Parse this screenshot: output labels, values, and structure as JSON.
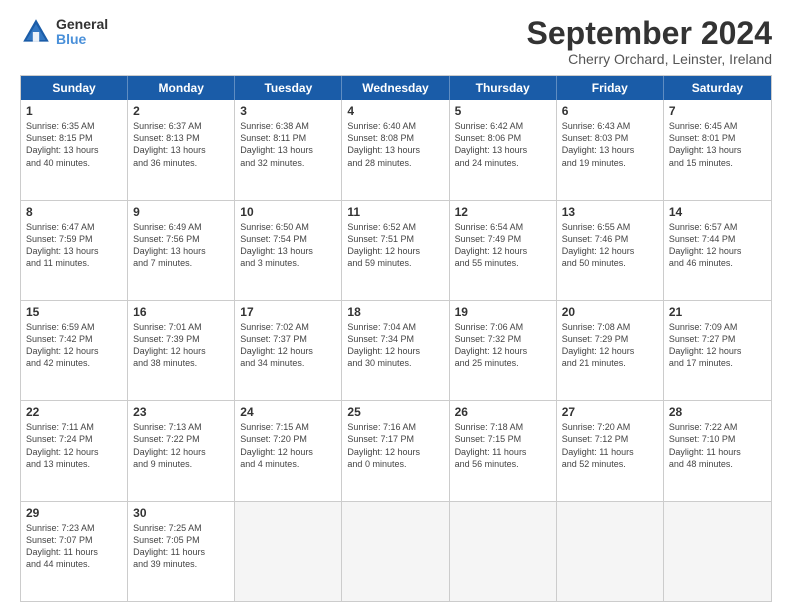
{
  "header": {
    "logo_line1": "General",
    "logo_line2": "Blue",
    "month_title": "September 2024",
    "location": "Cherry Orchard, Leinster, Ireland"
  },
  "days_of_week": [
    "Sunday",
    "Monday",
    "Tuesday",
    "Wednesday",
    "Thursday",
    "Friday",
    "Saturday"
  ],
  "rows": [
    [
      {
        "day": "1",
        "lines": [
          "Sunrise: 6:35 AM",
          "Sunset: 8:15 PM",
          "Daylight: 13 hours",
          "and 40 minutes."
        ]
      },
      {
        "day": "2",
        "lines": [
          "Sunrise: 6:37 AM",
          "Sunset: 8:13 PM",
          "Daylight: 13 hours",
          "and 36 minutes."
        ]
      },
      {
        "day": "3",
        "lines": [
          "Sunrise: 6:38 AM",
          "Sunset: 8:11 PM",
          "Daylight: 13 hours",
          "and 32 minutes."
        ]
      },
      {
        "day": "4",
        "lines": [
          "Sunrise: 6:40 AM",
          "Sunset: 8:08 PM",
          "Daylight: 13 hours",
          "and 28 minutes."
        ]
      },
      {
        "day": "5",
        "lines": [
          "Sunrise: 6:42 AM",
          "Sunset: 8:06 PM",
          "Daylight: 13 hours",
          "and 24 minutes."
        ]
      },
      {
        "day": "6",
        "lines": [
          "Sunrise: 6:43 AM",
          "Sunset: 8:03 PM",
          "Daylight: 13 hours",
          "and 19 minutes."
        ]
      },
      {
        "day": "7",
        "lines": [
          "Sunrise: 6:45 AM",
          "Sunset: 8:01 PM",
          "Daylight: 13 hours",
          "and 15 minutes."
        ]
      }
    ],
    [
      {
        "day": "8",
        "lines": [
          "Sunrise: 6:47 AM",
          "Sunset: 7:59 PM",
          "Daylight: 13 hours",
          "and 11 minutes."
        ]
      },
      {
        "day": "9",
        "lines": [
          "Sunrise: 6:49 AM",
          "Sunset: 7:56 PM",
          "Daylight: 13 hours",
          "and 7 minutes."
        ]
      },
      {
        "day": "10",
        "lines": [
          "Sunrise: 6:50 AM",
          "Sunset: 7:54 PM",
          "Daylight: 13 hours",
          "and 3 minutes."
        ]
      },
      {
        "day": "11",
        "lines": [
          "Sunrise: 6:52 AM",
          "Sunset: 7:51 PM",
          "Daylight: 12 hours",
          "and 59 minutes."
        ]
      },
      {
        "day": "12",
        "lines": [
          "Sunrise: 6:54 AM",
          "Sunset: 7:49 PM",
          "Daylight: 12 hours",
          "and 55 minutes."
        ]
      },
      {
        "day": "13",
        "lines": [
          "Sunrise: 6:55 AM",
          "Sunset: 7:46 PM",
          "Daylight: 12 hours",
          "and 50 minutes."
        ]
      },
      {
        "day": "14",
        "lines": [
          "Sunrise: 6:57 AM",
          "Sunset: 7:44 PM",
          "Daylight: 12 hours",
          "and 46 minutes."
        ]
      }
    ],
    [
      {
        "day": "15",
        "lines": [
          "Sunrise: 6:59 AM",
          "Sunset: 7:42 PM",
          "Daylight: 12 hours",
          "and 42 minutes."
        ]
      },
      {
        "day": "16",
        "lines": [
          "Sunrise: 7:01 AM",
          "Sunset: 7:39 PM",
          "Daylight: 12 hours",
          "and 38 minutes."
        ]
      },
      {
        "day": "17",
        "lines": [
          "Sunrise: 7:02 AM",
          "Sunset: 7:37 PM",
          "Daylight: 12 hours",
          "and 34 minutes."
        ]
      },
      {
        "day": "18",
        "lines": [
          "Sunrise: 7:04 AM",
          "Sunset: 7:34 PM",
          "Daylight: 12 hours",
          "and 30 minutes."
        ]
      },
      {
        "day": "19",
        "lines": [
          "Sunrise: 7:06 AM",
          "Sunset: 7:32 PM",
          "Daylight: 12 hours",
          "and 25 minutes."
        ]
      },
      {
        "day": "20",
        "lines": [
          "Sunrise: 7:08 AM",
          "Sunset: 7:29 PM",
          "Daylight: 12 hours",
          "and 21 minutes."
        ]
      },
      {
        "day": "21",
        "lines": [
          "Sunrise: 7:09 AM",
          "Sunset: 7:27 PM",
          "Daylight: 12 hours",
          "and 17 minutes."
        ]
      }
    ],
    [
      {
        "day": "22",
        "lines": [
          "Sunrise: 7:11 AM",
          "Sunset: 7:24 PM",
          "Daylight: 12 hours",
          "and 13 minutes."
        ]
      },
      {
        "day": "23",
        "lines": [
          "Sunrise: 7:13 AM",
          "Sunset: 7:22 PM",
          "Daylight: 12 hours",
          "and 9 minutes."
        ]
      },
      {
        "day": "24",
        "lines": [
          "Sunrise: 7:15 AM",
          "Sunset: 7:20 PM",
          "Daylight: 12 hours",
          "and 4 minutes."
        ]
      },
      {
        "day": "25",
        "lines": [
          "Sunrise: 7:16 AM",
          "Sunset: 7:17 PM",
          "Daylight: 12 hours",
          "and 0 minutes."
        ]
      },
      {
        "day": "26",
        "lines": [
          "Sunrise: 7:18 AM",
          "Sunset: 7:15 PM",
          "Daylight: 11 hours",
          "and 56 minutes."
        ]
      },
      {
        "day": "27",
        "lines": [
          "Sunrise: 7:20 AM",
          "Sunset: 7:12 PM",
          "Daylight: 11 hours",
          "and 52 minutes."
        ]
      },
      {
        "day": "28",
        "lines": [
          "Sunrise: 7:22 AM",
          "Sunset: 7:10 PM",
          "Daylight: 11 hours",
          "and 48 minutes."
        ]
      }
    ],
    [
      {
        "day": "29",
        "lines": [
          "Sunrise: 7:23 AM",
          "Sunset: 7:07 PM",
          "Daylight: 11 hours",
          "and 44 minutes."
        ]
      },
      {
        "day": "30",
        "lines": [
          "Sunrise: 7:25 AM",
          "Sunset: 7:05 PM",
          "Daylight: 11 hours",
          "and 39 minutes."
        ]
      },
      {
        "day": "",
        "lines": []
      },
      {
        "day": "",
        "lines": []
      },
      {
        "day": "",
        "lines": []
      },
      {
        "day": "",
        "lines": []
      },
      {
        "day": "",
        "lines": []
      }
    ]
  ]
}
